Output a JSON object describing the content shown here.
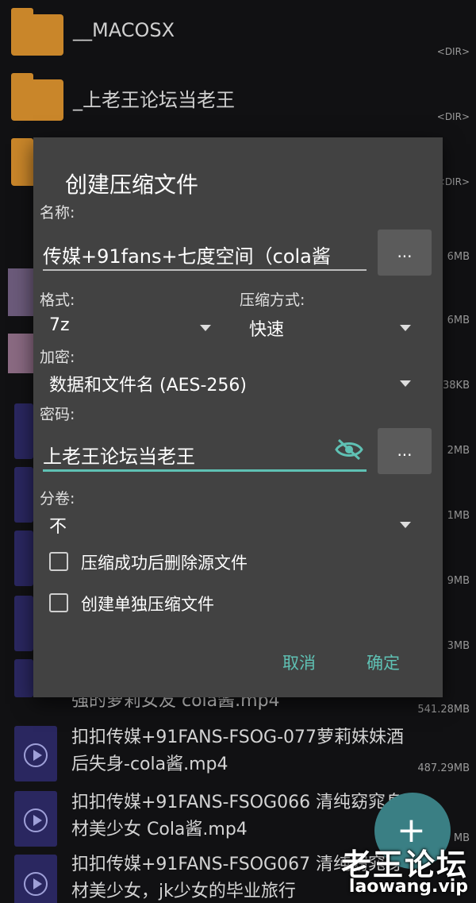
{
  "file_list": {
    "folders": [
      {
        "name": "__MACOSX",
        "tag": "<DIR>"
      },
      {
        "name": "_上老王论坛当老王",
        "tag": "<DIR>"
      },
      {
        "name": "",
        "tag": "<DIR>"
      }
    ],
    "sizes": [
      "6MB",
      "6MB",
      "38KB",
      "2MB",
      "1MB",
      "9MB",
      "3MB"
    ],
    "videos": [
      {
        "title": "强的萝莉女友 cola酱.mp4",
        "size": "541.28MB"
      },
      {
        "title": "扣扣传媒+91FANS-FSOG-077萝莉妹妹酒后失身-cola酱.mp4",
        "size": "487.29MB"
      },
      {
        "title": "扣扣传媒+91FANS-FSOG066 清纯窈窕身材美少女 Cola酱.mp4",
        "size": "MB"
      },
      {
        "title": "扣扣传媒+91FANS-FSOG067 清纯窈窕身材美少女，jk少女的毕业旅行",
        "size": ""
      }
    ]
  },
  "dialog": {
    "title": "创建压缩文件",
    "name_label": "名称:",
    "name_value": "传媒+91fans+七度空间（cola酱",
    "browse_button": "...",
    "format_label": "格式:",
    "format_value": "7z",
    "method_label": "压缩方式:",
    "method_value": "快速",
    "encryption_label": "加密:",
    "encryption_value": "数据和文件名 (AES-256)",
    "password_label": "密码:",
    "password_value": "上老王论坛当老王",
    "password_button": "...",
    "split_label": "分卷:",
    "split_value": "不",
    "delete_source_label": "压缩成功后删除源文件",
    "separate_archive_label": "创建单独压缩文件",
    "cancel_label": "取消",
    "ok_label": "确定"
  },
  "fab_label": "+",
  "watermark": {
    "line1": "老王论坛",
    "line2": "laowang.vip"
  },
  "colors": {
    "accent": "#5fc1b4",
    "folder": "#c9862a",
    "dialog_bg": "#424242"
  }
}
